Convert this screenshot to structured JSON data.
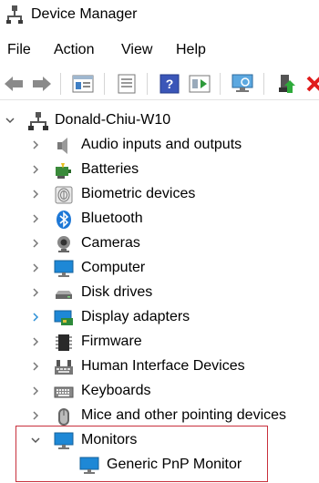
{
  "window": {
    "title": "Device Manager",
    "icon": "device-manager-icon"
  },
  "menu": [
    "File",
    "Action",
    "View",
    "Help"
  ],
  "toolbar": [
    "back-arrow-icon",
    "forward-arrow-icon",
    "properties-icon",
    "print-icon",
    "help-icon",
    "run-icon",
    "monitor-scan-icon",
    "update-driver-icon",
    "remove-icon"
  ],
  "tree": {
    "root": {
      "label": "Donald-Chiu-W10",
      "expanded": true,
      "icon": "computer-tree-icon"
    },
    "categories": [
      {
        "label": "Audio inputs and outputs",
        "icon": "speaker-icon",
        "expanded": false
      },
      {
        "label": "Batteries",
        "icon": "battery-icon",
        "expanded": false
      },
      {
        "label": "Biometric devices",
        "icon": "fingerprint-icon",
        "expanded": false
      },
      {
        "label": "Bluetooth",
        "icon": "bluetooth-icon",
        "expanded": false
      },
      {
        "label": "Cameras",
        "icon": "camera-icon",
        "expanded": false
      },
      {
        "label": "Computer",
        "icon": "computer-icon",
        "expanded": false
      },
      {
        "label": "Disk drives",
        "icon": "disk-drive-icon",
        "expanded": false
      },
      {
        "label": "Display adapters",
        "icon": "display-adapter-icon",
        "expanded": false
      },
      {
        "label": "Firmware",
        "icon": "firmware-icon",
        "expanded": false
      },
      {
        "label": "Human Interface Devices",
        "icon": "hid-icon",
        "expanded": false
      },
      {
        "label": "Keyboards",
        "icon": "keyboard-icon",
        "expanded": false
      },
      {
        "label": "Mice and other pointing devices",
        "icon": "mouse-icon",
        "expanded": false
      },
      {
        "label": "Monitors",
        "icon": "monitor-icon",
        "expanded": true,
        "children": [
          {
            "label": "Generic PnP Monitor",
            "icon": "monitor-icon"
          }
        ]
      }
    ]
  },
  "colors": {
    "highlight_border": "#c8303c",
    "chevron": "#6a6a6a",
    "chevron_hover": "#2b8fd6",
    "monitor_blue": "#1e88d6"
  }
}
